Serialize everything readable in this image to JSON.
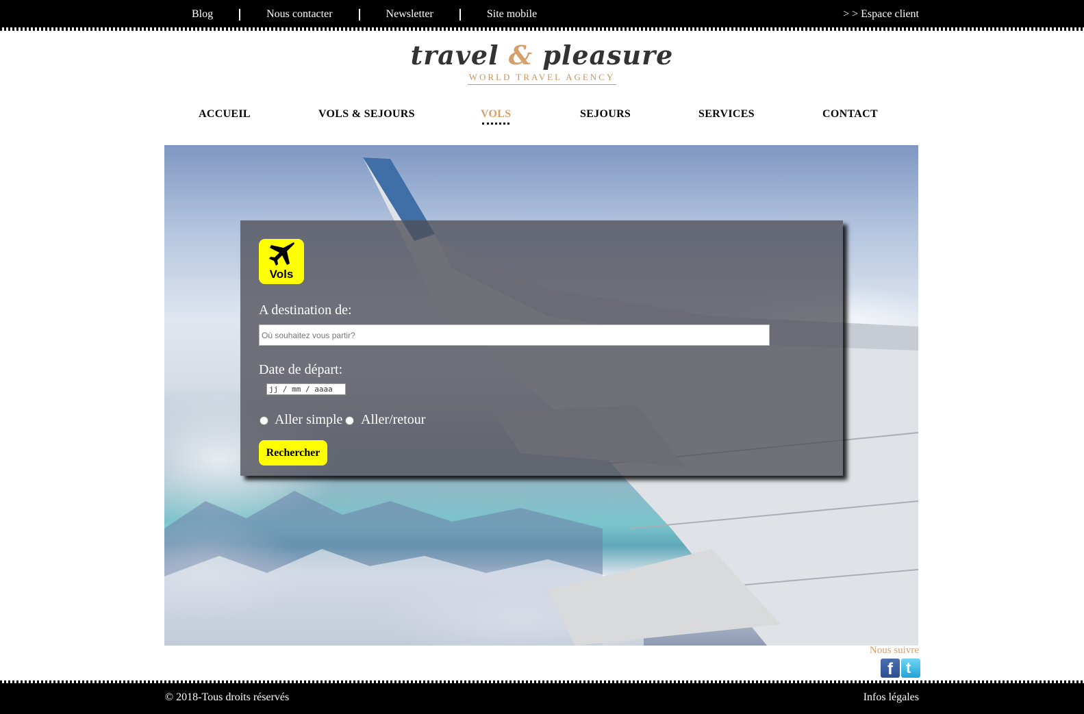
{
  "topbar": {
    "links": [
      "Blog",
      "Nous contacter",
      "Newsletter",
      "Site mobile"
    ],
    "account_link": "> > Espace client"
  },
  "logo": {
    "word1": "travel",
    "ampersand": "&",
    "word2": "pleasure",
    "tagline": "WORLD TRAVEL AGENCY"
  },
  "nav": {
    "items": [
      "ACCUEIL",
      "VOLS & SEJOURS",
      "VOLS",
      "SEJOURS",
      "SERVICES",
      "CONTACT"
    ],
    "active": "VOLS"
  },
  "search": {
    "badge_label": "Vols",
    "destination_label": "A destination de:",
    "destination_placeholder": "Où souhaitez vous partir?",
    "date_label": "Date de départ:",
    "date_placeholder": "jj / mm / aaaa",
    "trip_options": [
      "Aller simple",
      "Aller/retour"
    ],
    "submit_label": "Rechercher"
  },
  "follow": {
    "label": "Nous suivre",
    "networks": [
      "facebook-icon",
      "twitter-icon"
    ]
  },
  "footer": {
    "copyright": "© 2018-Tous droits réservés",
    "legal": "Infos légales"
  },
  "colors": {
    "accent_gold": "#d7a06a",
    "highlight_yellow": "#ffff00",
    "bar_black": "#000000"
  }
}
